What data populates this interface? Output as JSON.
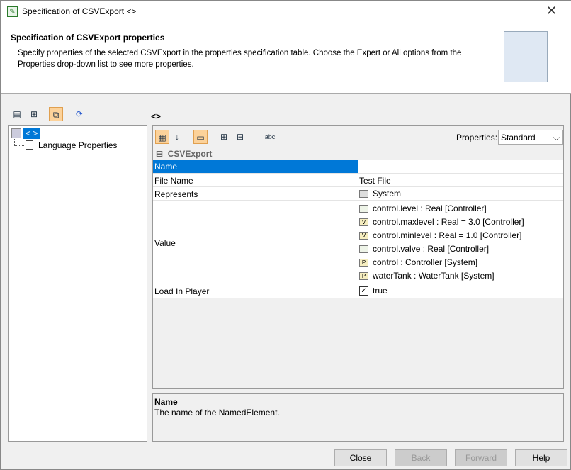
{
  "window": {
    "title": "Specification of CSVExport <>",
    "close": "✕"
  },
  "header": {
    "title": "Specification of CSVExport properties",
    "description": "Specify properties of the selected CSVExport in the properties specification table. Choose the Expert or All options from the Properties drop-down list to see more properties."
  },
  "element_label": "<>",
  "tree": {
    "root": "< >",
    "child": "Language Properties"
  },
  "grid": {
    "properties_label": "Properties:",
    "properties_value": "Standard",
    "group": "CSVExport",
    "rows": [
      {
        "name": "Name",
        "value": ""
      },
      {
        "name": "File Name",
        "value": "Test File"
      },
      {
        "name": "Represents",
        "value": "System"
      },
      {
        "name": "Value",
        "values": [
          {
            "icon": "",
            "text": "control.level : Real [Controller]"
          },
          {
            "icon": "V",
            "text": "control.maxlevel : Real = 3.0 [Controller]"
          },
          {
            "icon": "V",
            "text": "control.minlevel : Real = 1.0 [Controller]"
          },
          {
            "icon": "",
            "text": "control.valve : Real [Controller]"
          },
          {
            "icon": "P",
            "text": "control : Controller [System]"
          },
          {
            "icon": "P",
            "text": "waterTank : WaterTank [System]"
          }
        ]
      },
      {
        "name": "Load In Player",
        "value": "true"
      }
    ]
  },
  "description": {
    "title": "Name",
    "text": "The name of the NamedElement."
  },
  "buttons": {
    "close": "Close",
    "back": "Back",
    "forward": "Forward",
    "help": "Help"
  }
}
